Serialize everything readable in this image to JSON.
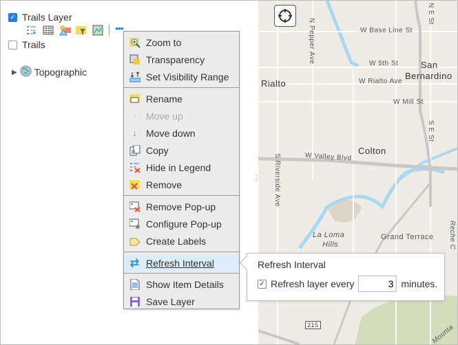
{
  "layers": [
    {
      "label": "Trails Layer",
      "checked": true
    },
    {
      "label": "Trails",
      "checked": false
    },
    {
      "label": "Topographic"
    }
  ],
  "toolbar_icons": [
    "legend-icon",
    "table-icon",
    "change-style-icon",
    "filter-icon",
    "basemap-icon",
    "more-options-icon"
  ],
  "menu": {
    "group1": [
      "Zoom to",
      "Transparency",
      "Set Visibility Range"
    ],
    "group2": [
      "Rename",
      "Move up",
      "Move down",
      "Copy",
      "Hide in Legend",
      "Remove"
    ],
    "group3": [
      "Remove Pop-up",
      "Configure Pop-up",
      "Create Labels"
    ],
    "group4": [
      "Refresh Interval"
    ],
    "group5": [
      "Show Item Details",
      "Save Layer"
    ]
  },
  "refresh_popup": {
    "title": "Refresh Interval",
    "checkbox_label": "Refresh layer every",
    "value": "3",
    "unit": "minutes.",
    "checked": true
  },
  "map_labels": {
    "base_line": "W Base Line St",
    "pepper": "N Pepper Ave",
    "fifth": "W 5th St",
    "san": "San",
    "bernardino": "Bernardino",
    "rialto": "Rialto",
    "rialto_ave": "W Rialto Ave",
    "mill": "W Mill St",
    "se": "S E St",
    "ne": "N E St",
    "colton": "Colton",
    "valley": "W Valley Blvd",
    "riverside": "S Riverside Ave",
    "laloma": "La Loma",
    "hills": "Hills",
    "grand": "Grand Terrace",
    "shield": "215",
    "mount": "Mounta",
    "reche": "Reche C"
  },
  "colors": {
    "accent": "#2d7be5",
    "water": "#a9d8f2",
    "highlight": "#dcecf8"
  }
}
